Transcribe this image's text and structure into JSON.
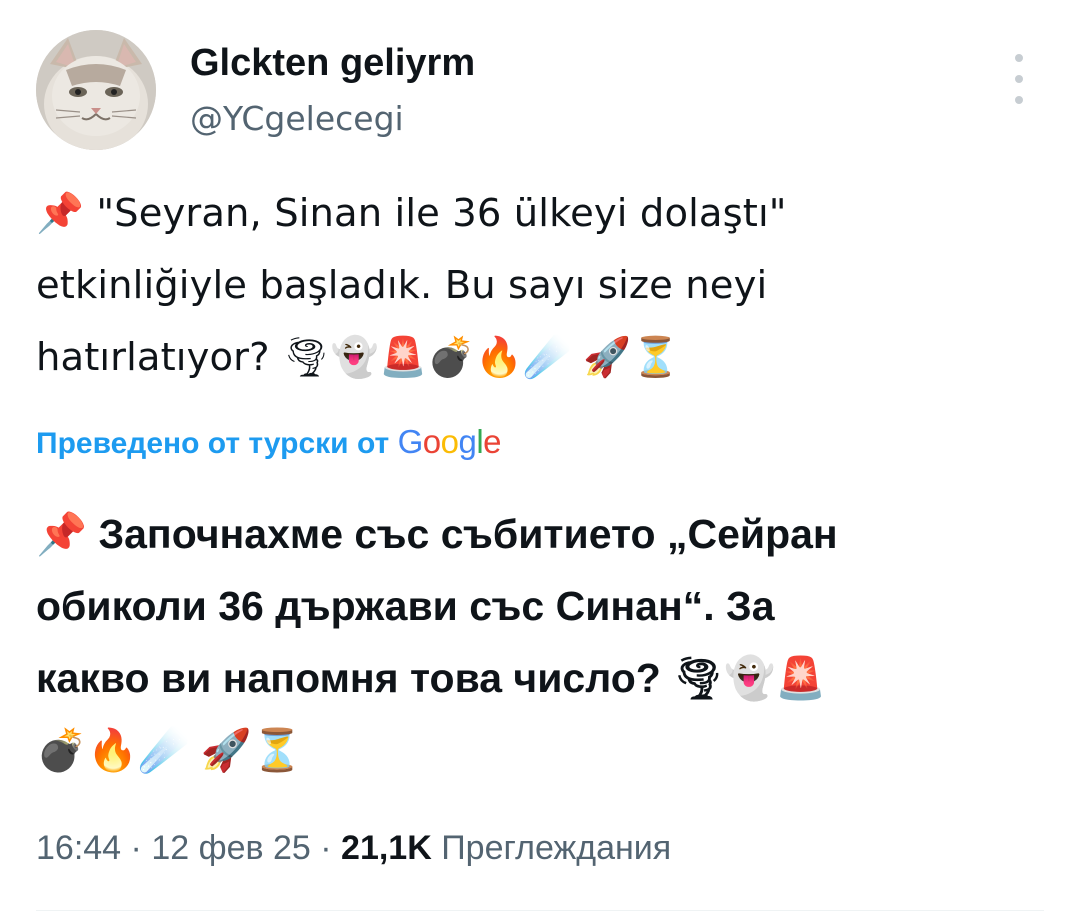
{
  "author": {
    "display_name": "Glckten geliyrm",
    "handle": "@YCgelecegi",
    "avatar_icon": "cat-avatar"
  },
  "tweet": {
    "text": "📌 \"Seyran, Sinan ile 36 ülkeyi dolaştı\"\netkinliğiyle başladık. Bu sayı size neyi\nhatırlatıyor? 🌪👻🚨💣🔥☄️ 🚀⏳"
  },
  "translation": {
    "label": "Преведено от турски от",
    "provider": "Google",
    "text": "📌 Започнахме със събитието „Сейран\nобиколи 36 държави със Синан“. За\nкакво ви напомня това число? 🌪👻🚨\n💣🔥☄️ 🚀⏳"
  },
  "meta": {
    "time": "16:44",
    "separator": "·",
    "date": "12 фев 25",
    "views_count": "21,1K",
    "views_label": "Преглеждания"
  },
  "more_icon": "more-vertical-icon"
}
